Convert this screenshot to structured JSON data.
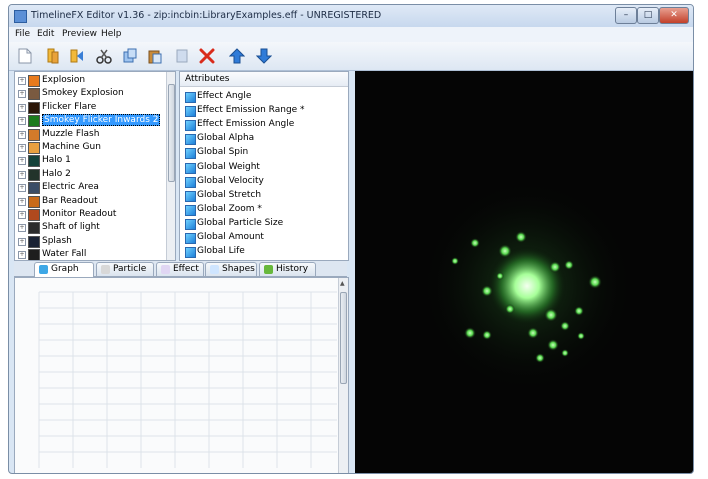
{
  "window": {
    "title": "TimelineFX Editor v1.36 - zip:incbin:LibraryExamples.eff - UNREGISTERED",
    "controls": {
      "minimize": "–",
      "maximize": "□",
      "close": "✕"
    }
  },
  "menu": [
    "File",
    "Edit",
    "Preview",
    "Help"
  ],
  "toolbar": [
    "new-document-icon",
    "open-folder-icon",
    "import-icon",
    "cut-icon",
    "copy-icon",
    "paste-icon",
    "clear-icon",
    "delete-icon",
    "move-up-icon",
    "move-down-icon"
  ],
  "effects_tree": {
    "selected": "Smokey Flicker Inwards 2",
    "items": [
      {
        "label": "Explosion",
        "thumb_color": "#e87b1e"
      },
      {
        "label": "Smokey Explosion",
        "thumb_color": "#7a5a40"
      },
      {
        "label": "Flicker Flare",
        "thumb_color": "#2b1608"
      },
      {
        "label": "Smokey Flicker Inwards 2",
        "thumb_color": "#1c7a1c"
      },
      {
        "label": "Muzzle Flash",
        "thumb_color": "#d27a2a"
      },
      {
        "label": "Machine Gun",
        "thumb_color": "#e9a040"
      },
      {
        "label": "Halo 1",
        "thumb_color": "#16423a"
      },
      {
        "label": "Halo 2",
        "thumb_color": "#22332b"
      },
      {
        "label": "Electric Area",
        "thumb_color": "#3b4d66"
      },
      {
        "label": "Bar Readout",
        "thumb_color": "#c96b1a"
      },
      {
        "label": "Monitor Readout",
        "thumb_color": "#b0491e"
      },
      {
        "label": "Shaft of light",
        "thumb_color": "#2c2c2c"
      },
      {
        "label": "Splash",
        "thumb_color": "#1a2233"
      },
      {
        "label": "Water Fall",
        "thumb_color": "#1e1e1e"
      }
    ]
  },
  "attributes": {
    "header": "Attributes",
    "items": [
      "Effect Angle",
      "Effect Emission Range *",
      "Effect Emission Angle",
      "Global Alpha",
      "Global Spin",
      "Global Weight",
      "Global Velocity",
      "Global Stretch",
      "Global Zoom *",
      "Global Particle Size",
      "Global Amount",
      "Global Life"
    ]
  },
  "graph_tabs": {
    "active": "Graph",
    "items": [
      {
        "label": "Graph",
        "icon": "graph-icon",
        "color": "#3da7e6"
      },
      {
        "label": "Particle",
        "icon": "particle-icon",
        "color": "#d8d8d8"
      },
      {
        "label": "Effect",
        "icon": "effect-icon",
        "color": "#e0d6f3"
      },
      {
        "label": "Shapes",
        "icon": "shapes-icon",
        "color": "#cfe5ff"
      },
      {
        "label": "History",
        "icon": "history-icon",
        "color": "#67b83c"
      }
    ]
  },
  "colors": {
    "selection": "#3399ff",
    "preview_background": "#050505",
    "particle_glow": "#6dff6d"
  }
}
